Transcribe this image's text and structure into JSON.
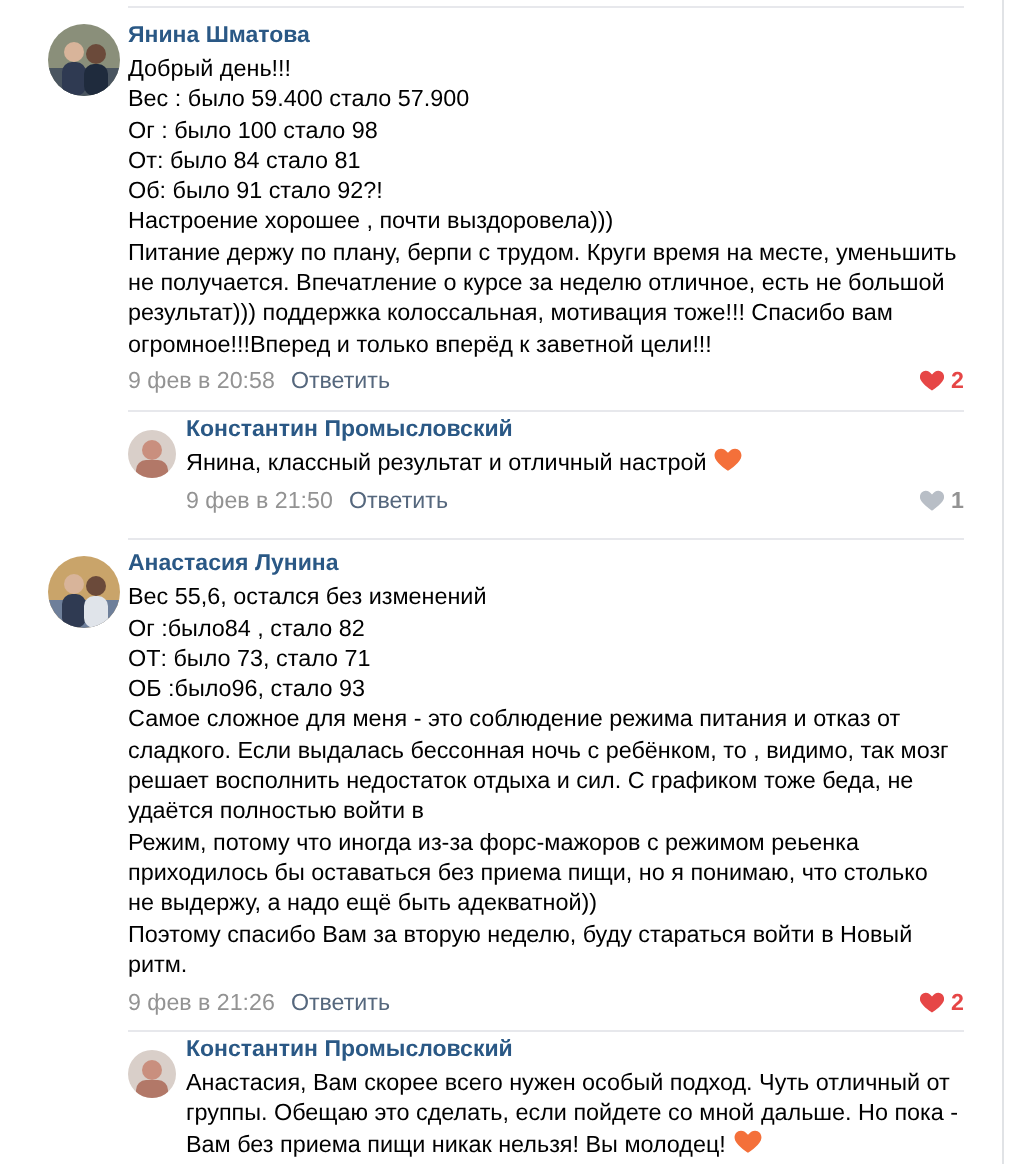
{
  "comments": [
    {
      "author": "Янина Шматова",
      "text": "Добрый день!!!\nВес : было 59.400 стало 57.900\nОг : было 100 стало 98\nОт: было 84 стало 81\nОб: было 91 стало 92?!\nНастроение хорошее , почти выздоровела)))\nПитание держу по плану, берпи с трудом. Круги время на месте, уменьшить\nне получается. Впечатление о курсе за неделю отличное, есть не большой\nрезультат))) поддержка колоссальная, мотивация тоже!!! Спасибо вам\nогромное!!!Вперед и только вперёд к заветной цели!!!",
      "date": "9 фев в 20:58",
      "reply_label": "Ответить",
      "likes": "2",
      "liked": true,
      "replies": [
        {
          "author": "Константин Промысловский",
          "text": "Янина, классный результат и отличный настрой",
          "trailing_heart": true,
          "date": "9 фев в 21:50",
          "reply_label": "Ответить",
          "likes": "1",
          "liked": false
        }
      ]
    },
    {
      "author": "Анастасия Лунина",
      "text": "Вес 55,6, остался без изменений\nОг :было84 , стало 82\nОТ: было 73, стало 71\nОБ :было96, стало 93\nСамое сложное для меня - это соблюдение режима питания и отказ от\nсладкого. Если выдалась бессонная ночь с ребёнком, то , видимо, так мозг\nрешает восполнить недостаток отдыха и сил. С графиком тоже беда, не\nудаётся полностью войти в\nРежим, потому что иногда из-за форс-мажоров с режимом реьенка\nприходилось бы оставаться без приема пищи, но я понимаю, что столько\nне выдержу, а надо ещё быть адекватной))\nПоэтому спасибо Вам за вторую неделю, буду стараться войти в Новый\nритм.",
      "date": "9 фев в 21:26",
      "reply_label": "Ответить",
      "likes": "2",
      "liked": true,
      "replies": [
        {
          "author": "Константин Промысловский",
          "text": "Анастасия, Вам скорее всего нужен особый подход. Чуть отличный от\nгруппы. Обещаю это сделать, если пойдете со мной дальше. Но пока -\nВам без приема пищи никак нельзя! Вы молодец!",
          "trailing_heart": true
        }
      ]
    }
  ]
}
